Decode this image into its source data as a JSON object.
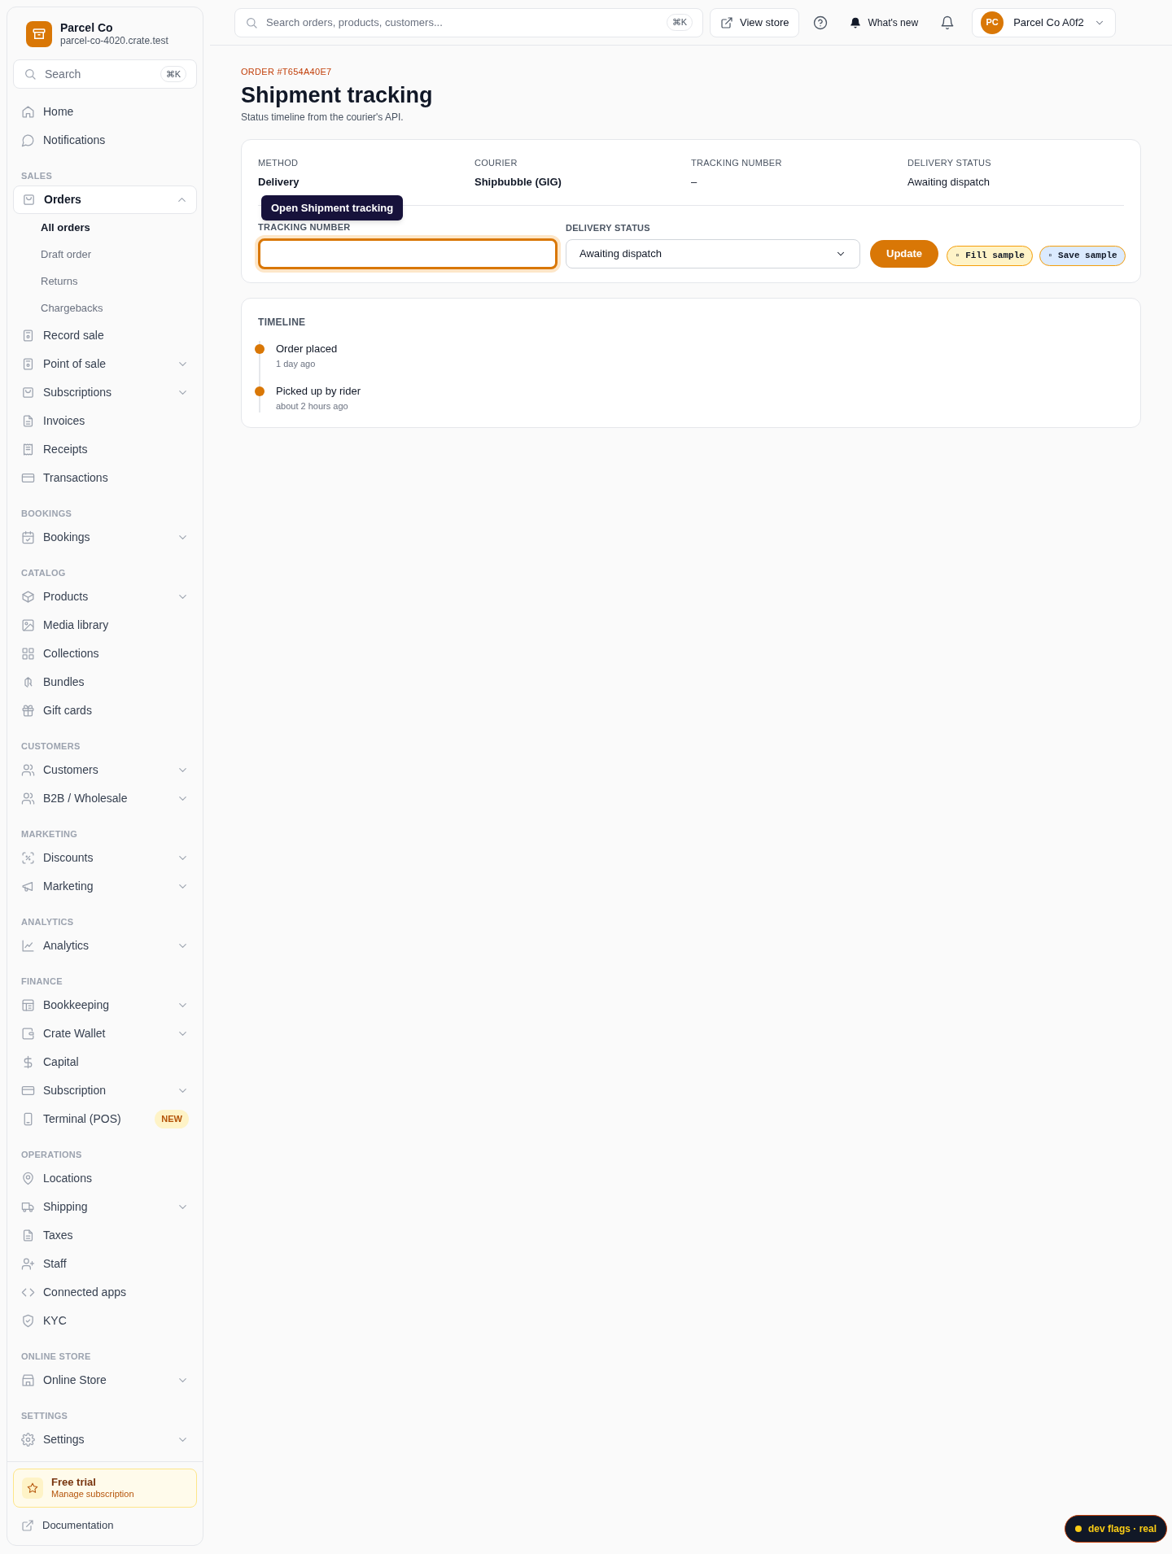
{
  "sidebar": {
    "brand": {
      "name": "Parcel Co",
      "domain": "parcel-co-4020.crate.test"
    },
    "search": {
      "placeholder": "Search",
      "shortcut": "⌘K"
    },
    "sections": [
      {
        "items": [
          {
            "label": "Home",
            "selected": false
          },
          {
            "label": "Notifications",
            "selected": false
          }
        ]
      },
      {
        "heading": "SALES",
        "items": [
          {
            "label": "Orders",
            "selected": true,
            "expanded": true,
            "children": [
              {
                "label": "All orders",
                "selected": true
              },
              {
                "label": "Draft order",
                "selected": false
              },
              {
                "label": "Returns",
                "selected": false
              },
              {
                "label": "Chargebacks",
                "selected": false
              }
            ]
          },
          {
            "label": "Record sale",
            "selected": false
          },
          {
            "label": "Point of sale",
            "selected": false,
            "expanded": false
          },
          {
            "label": "Subscriptions",
            "selected": false,
            "expanded": false
          },
          {
            "label": "Invoices",
            "selected": false
          },
          {
            "label": "Receipts",
            "selected": false
          },
          {
            "label": "Transactions",
            "selected": false
          }
        ]
      },
      {
        "heading": "BOOKINGS",
        "items": [
          {
            "label": "Bookings",
            "selected": false,
            "expanded": false
          }
        ]
      },
      {
        "heading": "CATALOG",
        "items": [
          {
            "label": "Products",
            "selected": false,
            "expanded": false
          },
          {
            "label": "Media library",
            "selected": false
          },
          {
            "label": "Collections",
            "selected": false
          },
          {
            "label": "Bundles",
            "selected": false
          },
          {
            "label": "Gift cards",
            "selected": false
          }
        ]
      },
      {
        "heading": "CUSTOMERS",
        "items": [
          {
            "label": "Customers",
            "selected": false,
            "expanded": false
          },
          {
            "label": "B2B / Wholesale",
            "selected": false,
            "expanded": false
          }
        ]
      },
      {
        "heading": "MARKETING",
        "items": [
          {
            "label": "Discounts",
            "selected": false,
            "expanded": false
          },
          {
            "label": "Marketing",
            "selected": false,
            "expanded": false
          }
        ]
      },
      {
        "heading": "ANALYTICS",
        "items": [
          {
            "label": "Analytics",
            "selected": false,
            "expanded": false
          }
        ]
      },
      {
        "heading": "FINANCE",
        "items": [
          {
            "label": "Bookkeeping",
            "selected": false,
            "expanded": false
          },
          {
            "label": "Crate Wallet",
            "selected": false,
            "expanded": false
          },
          {
            "label": "Capital",
            "selected": false
          },
          {
            "label": "Subscription",
            "selected": false,
            "expanded": false
          },
          {
            "label": "Terminal (POS)",
            "selected": false,
            "badge": "NEW"
          }
        ]
      },
      {
        "heading": "OPERATIONS",
        "items": [
          {
            "label": "Locations",
            "selected": false
          },
          {
            "label": "Shipping",
            "selected": false,
            "expanded": false
          },
          {
            "label": "Taxes",
            "selected": false
          },
          {
            "label": "Staff",
            "selected": false
          },
          {
            "label": "Connected apps",
            "selected": false
          },
          {
            "label": "KYC",
            "selected": false
          }
        ]
      },
      {
        "heading": "ONLINE STORE",
        "items": [
          {
            "label": "Online Store",
            "selected": false,
            "expanded": false
          }
        ]
      },
      {
        "heading": "SETTINGS",
        "items": [
          {
            "label": "Settings",
            "selected": false,
            "expanded": false
          }
        ]
      }
    ],
    "trial": {
      "title": "Free trial",
      "subtitle": "Manage subscription"
    },
    "footer_link": "Documentation"
  },
  "top_bar": {
    "search": {
      "placeholder": "Search orders, products, customers...",
      "shortcut": "⌘K"
    },
    "view_store": "View store",
    "whats_new": "What's new",
    "account": {
      "initials": "PC",
      "name": "Parcel Co A0f2"
    }
  },
  "page": {
    "eyebrow": "ORDER #T654A40E7",
    "title": "Shipment tracking",
    "subtitle": "Status timeline from the courier's API."
  },
  "summary": [
    {
      "label": "METHOD",
      "value": "Delivery",
      "bold": true
    },
    {
      "label": "COURIER",
      "value": "Shipbubble (GIG)",
      "bold": true
    },
    {
      "label": "TRACKING NUMBER",
      "value": "–",
      "bold": false
    },
    {
      "label": "DELIVERY STATUS",
      "value": "Awaiting dispatch",
      "bold": false
    }
  ],
  "form": {
    "tracking_label": "TRACKING NUMBER",
    "tracking_focused": true,
    "status_label": "DELIVERY STATUS",
    "status_value": "Awaiting dispatch",
    "update": "Update",
    "tooltip": "Open Shipment tracking"
  },
  "samples": [
    {
      "label": "▫ Fill sample",
      "color": "#fef3c7"
    },
    {
      "label": "▫ Save sample",
      "color": "#dbeafe"
    }
  ],
  "timeline": {
    "heading": "TIMELINE",
    "events": [
      {
        "title": "Order placed",
        "time": "1 day ago"
      },
      {
        "title": "Picked up by rider",
        "time": "about 2 hours ago"
      }
    ]
  },
  "dev_flag": "dev flags · real"
}
